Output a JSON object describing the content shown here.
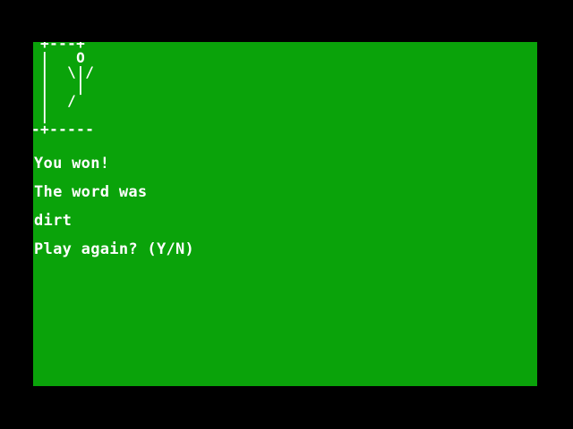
{
  "colors": {
    "screen_background": "#0aa30a",
    "bezel": "#000000",
    "text": "#ffffff"
  },
  "gallows": {
    "art": " +---+\n |   O\n |  \\|/\n |   |\n |  /\n |\n-+-----"
  },
  "terminal": {
    "lines": [
      "You won!",
      "The word was",
      "dirt",
      "Play again? (Y/N)"
    ]
  }
}
